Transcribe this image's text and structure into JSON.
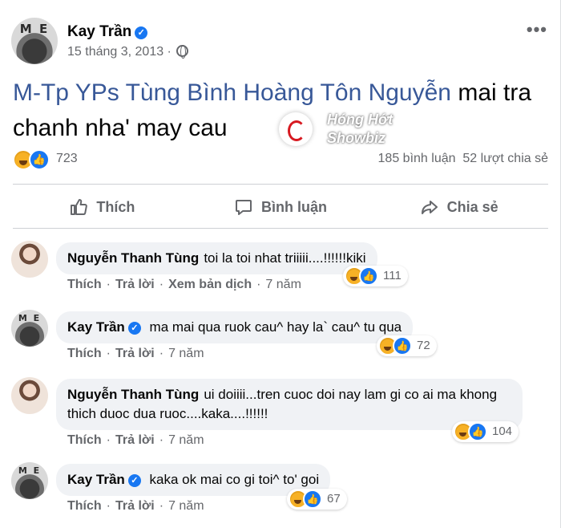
{
  "post": {
    "author": "Kay Trần",
    "date": "15 tháng 3, 2013 ·",
    "more_label": "•••",
    "text_tag": "M-Tp YPs Tùng Bình Hoàng Tôn Nguyễn",
    "text_rest": " mai tra chanh nha' may cau ",
    "watermark_line1": "Hóng Hớt",
    "watermark_line2": "Showbiz",
    "reaction_count": "723",
    "comments_count": "185 bình luận",
    "shares_count": "52 lượt chia sẻ"
  },
  "actions": {
    "like": "Thích",
    "comment": "Bình luận",
    "share": "Chia sẻ"
  },
  "comments": [
    {
      "name": "Nguyễn Thanh Tùng",
      "text": "toi la toi nhat triiiii....!!!!!!kiki",
      "like": "Thích",
      "reply": "Trả lời",
      "translate": "Xem bản dịch",
      "time": "7 năm",
      "reactions": "111"
    },
    {
      "name": "Kay Trần",
      "text": "ma mai qua ruok cau^ hay la` cau^ tu qua",
      "like": "Thích",
      "reply": "Trả lời",
      "time": "7 năm",
      "reactions": "72"
    },
    {
      "name": "Nguyễn Thanh Tùng",
      "text": "ui doiiii...tren cuoc doi nay lam gi co ai ma khong thich duoc dua ruoc....kaka....!!!!!!",
      "like": "Thích",
      "reply": "Trả lời",
      "time": "7 năm",
      "reactions": "104"
    },
    {
      "name": "Kay Trần",
      "text": "kaka ok mai co gi toi^ to' goi",
      "like": "Thích",
      "reply": "Trả lời",
      "time": "7 năm",
      "reactions": "67"
    }
  ],
  "icons": {
    "verified": "verified-badge-icon",
    "globe": "globe-icon",
    "haha": "haha-reaction-icon",
    "like": "like-reaction-icon"
  },
  "colors": {
    "accent": "#1877f2",
    "tag": "#385898",
    "secondary_text": "#65676b",
    "bubble": "#f0f2f5"
  }
}
